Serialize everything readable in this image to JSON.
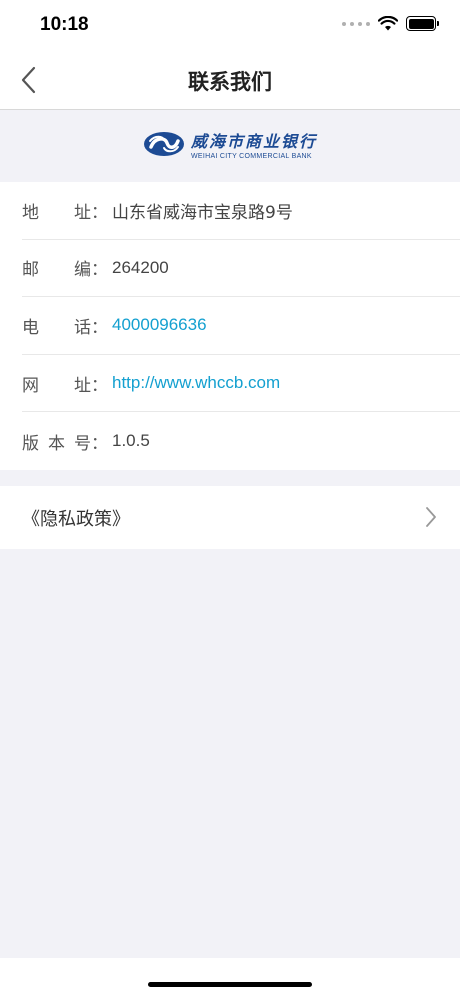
{
  "status_bar": {
    "time": "10:18"
  },
  "nav": {
    "title": "联系我们"
  },
  "logo": {
    "name_cn": "威海市商业银行",
    "name_en": "WEIHAI CITY COMMERCIAL BANK"
  },
  "info": {
    "rows": [
      {
        "label_a": "地",
        "label_b": "址",
        "value": "山东省威海市宝泉路9号"
      },
      {
        "label_a": "邮",
        "label_b": "编",
        "value": "264200"
      },
      {
        "label_a": "电",
        "label_b": "话",
        "value": "4000096636"
      },
      {
        "label_a": "网",
        "label_b": "址",
        "value": "http://www.whccb.com"
      },
      {
        "label_a": "版",
        "label_m": "本",
        "label_b": "号",
        "value": "1.0.5"
      }
    ],
    "colon": "："
  },
  "privacy": {
    "label": "《隐私政策》"
  },
  "colors": {
    "link": "#14a0d0",
    "brand": "#1d4b94",
    "background": "#f2f2f7"
  }
}
